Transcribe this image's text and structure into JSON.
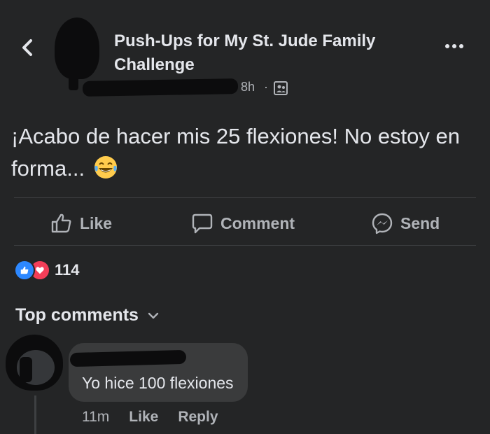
{
  "header": {
    "group_name": "Push-Ups for My St. Jude Family Challenge",
    "post_time": "8h",
    "separator": "·"
  },
  "post": {
    "text": "¡Acabo de hacer mis 25 flexiones! No estoy en forma...",
    "emoji": "face-with-tears-of-joy"
  },
  "actions": {
    "like": "Like",
    "comment": "Comment",
    "send": "Send"
  },
  "reactions": {
    "count": "114"
  },
  "comments": {
    "section_label": "Top comments",
    "items": [
      {
        "text": "Yo hice 100 flexiones",
        "time": "11m",
        "like": "Like",
        "reply": "Reply"
      }
    ]
  },
  "colors": {
    "background": "#242526",
    "text": "#e4e6eb",
    "secondary_text": "#b0b3b8",
    "like_blue": "#2d88ff",
    "love_red": "#f33e58",
    "bubble": "#3a3b3c"
  }
}
